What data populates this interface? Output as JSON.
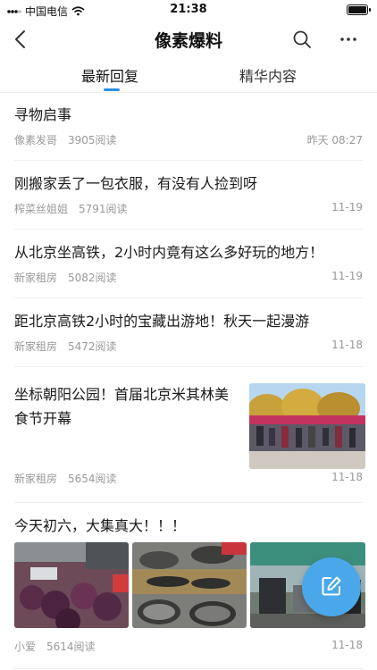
{
  "status_bar": {
    "carrier": "中国电信",
    "time": "21:38"
  },
  "nav": {
    "title": "像素爆料"
  },
  "tabs": [
    {
      "label": "最新回复",
      "active": true
    },
    {
      "label": "精华内容",
      "active": false
    }
  ],
  "accent_color": "#2a8fe0",
  "items": [
    {
      "title": "寻物启事",
      "author": "像素发哥",
      "reads": "3905阅读",
      "time": "昨天 08:27"
    },
    {
      "title": "刚搬家丢了一包衣服，有没有人捡到呀",
      "author": "榨菜丝姐姐",
      "reads": "5791阅读",
      "time": "11-19"
    },
    {
      "title": "从北京坐高铁，2小时内竟有这么多好玩的地方！",
      "author": "新家租房",
      "reads": "5082阅读",
      "time": "11-19"
    },
    {
      "title": "距北京高铁2小时的宝藏出游地！秋天一起漫游",
      "author": "新家租房",
      "reads": "5472阅读",
      "time": "11-18"
    },
    {
      "title": "坐标朝阳公园！首届北京米其林美食节开幕",
      "author": "新家租房",
      "reads": "5654阅读",
      "time": "11-18"
    },
    {
      "title": "今天初六，大集真大！！！",
      "author": "小爱",
      "reads": "5614阅读",
      "time": "11-18"
    }
  ]
}
